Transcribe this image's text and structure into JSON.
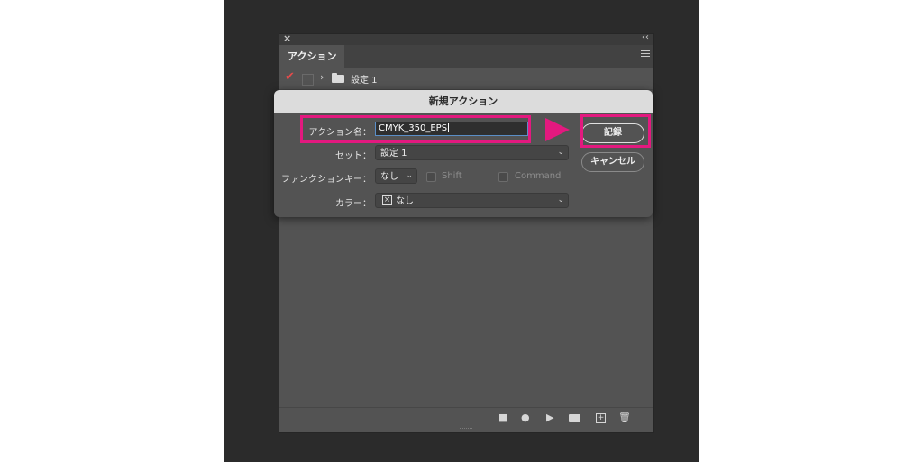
{
  "panel": {
    "tab_label": "アクション",
    "close_glyph": "×",
    "collapse_glyph": "‹‹",
    "set_name": "設定 1"
  },
  "dialog": {
    "title": "新規アクション",
    "name_label": "アクション名：",
    "name_value": "CMYK_350_EPS",
    "set_label": "セット：",
    "set_value": "設定 1",
    "function_key_label": "ファンクションキー：",
    "function_key_value": "なし",
    "shift_label": "Shift",
    "command_label": "Command",
    "color_label": "カラー：",
    "color_value": "なし",
    "record_button": "記録",
    "cancel_button": "キャンセル"
  },
  "colors": {
    "annotation": "#e3197f",
    "panel_bg": "#535353",
    "canvas_bg": "#2b2b2b"
  },
  "icons": [
    "close-icon",
    "collapse-icon",
    "panel-menu-icon",
    "checkmark-icon",
    "dialog-toggle-icon",
    "chevron-right-icon",
    "folder-icon",
    "stop-icon",
    "record-icon",
    "play-icon",
    "new-set-icon",
    "new-action-icon",
    "trash-icon",
    "no-color-icon",
    "dropdown-chevron-icon"
  ]
}
